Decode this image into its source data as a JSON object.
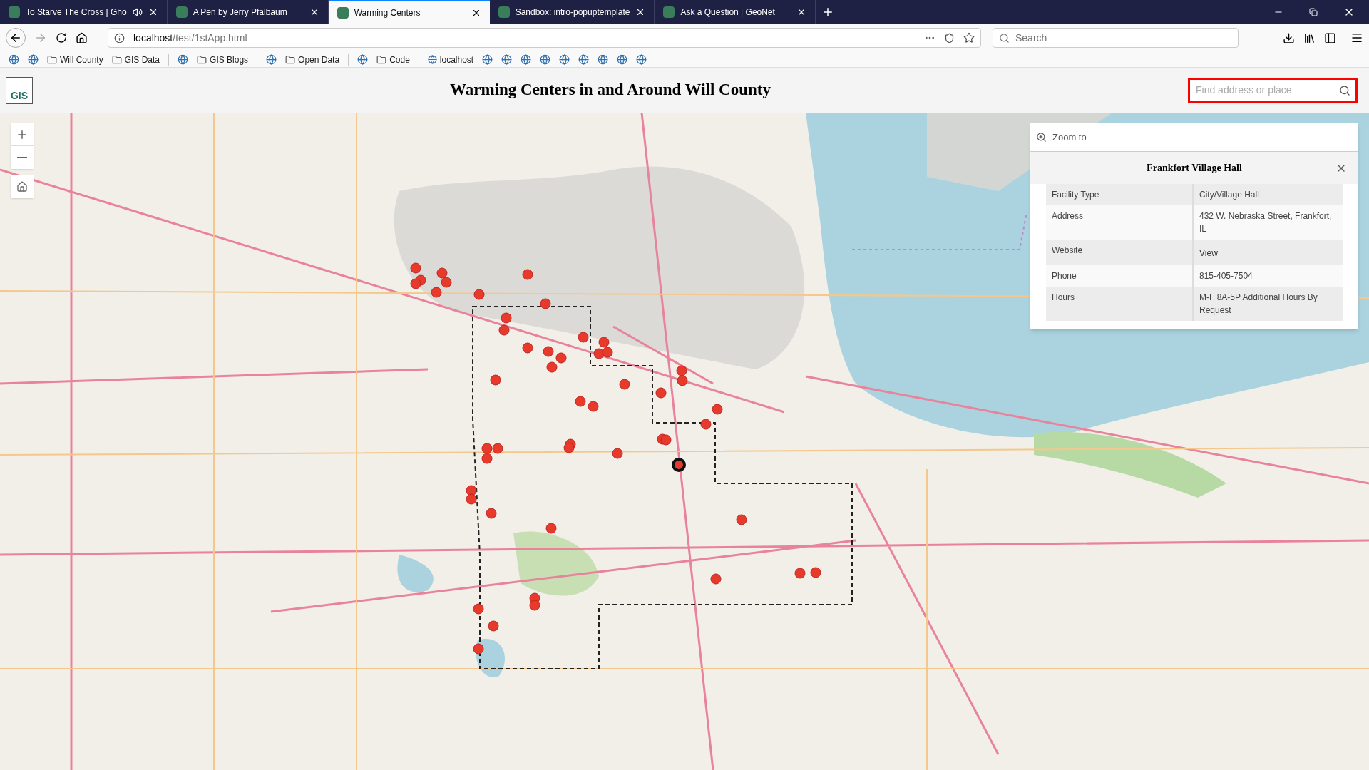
{
  "browser": {
    "tabs": [
      {
        "title": "To Starve The Cross | Gho",
        "selected": false,
        "audio": true
      },
      {
        "title": "A Pen by Jerry Pfalbaum",
        "selected": false,
        "audio": false
      },
      {
        "title": "Warming Centers",
        "selected": true,
        "audio": false
      },
      {
        "title": "Sandbox: intro-popuptemplate",
        "selected": false,
        "audio": false
      },
      {
        "title": "Ask a Question | GeoNet",
        "selected": false,
        "audio": false
      }
    ],
    "address": {
      "host": "localhost",
      "path": "/test/1stApp.html"
    },
    "search": {
      "placeholder": "Search"
    },
    "bookmarks": [
      {
        "kind": "site"
      },
      {
        "kind": "site"
      },
      {
        "kind": "folder",
        "label": "Will County"
      },
      {
        "kind": "folder",
        "label": "GIS Data"
      },
      {
        "kind": "separator"
      },
      {
        "kind": "site"
      },
      {
        "kind": "folder",
        "label": "GIS Blogs"
      },
      {
        "kind": "separator"
      },
      {
        "kind": "site"
      },
      {
        "kind": "folder",
        "label": "Open Data"
      },
      {
        "kind": "separator"
      },
      {
        "kind": "site"
      },
      {
        "kind": "folder",
        "label": "Code"
      },
      {
        "kind": "separator"
      },
      {
        "kind": "site",
        "label": "localhost"
      },
      {
        "kind": "site"
      },
      {
        "kind": "site"
      },
      {
        "kind": "site"
      },
      {
        "kind": "site"
      },
      {
        "kind": "site"
      },
      {
        "kind": "site"
      },
      {
        "kind": "site"
      },
      {
        "kind": "site"
      },
      {
        "kind": "site"
      }
    ]
  },
  "page": {
    "logo": "GIS",
    "title": "Warming Centers in and Around Will County",
    "search": {
      "placeholder": "Find address or place"
    }
  },
  "popup": {
    "action": "Zoom to",
    "title": "Frankfort Village Hall",
    "rows": [
      {
        "label": "Facility Type",
        "value": "City/Village Hall",
        "kind": "text"
      },
      {
        "label": "Address",
        "value": "432 W. Nebraska Street, Frankfort, IL",
        "kind": "text"
      },
      {
        "label": "Website",
        "value": "View",
        "kind": "link"
      },
      {
        "label": "Phone",
        "value": "815-405-7504",
        "kind": "text"
      },
      {
        "label": "Hours",
        "value": "M-F 8A-5P Additional Hours By Request",
        "kind": "text"
      }
    ]
  }
}
